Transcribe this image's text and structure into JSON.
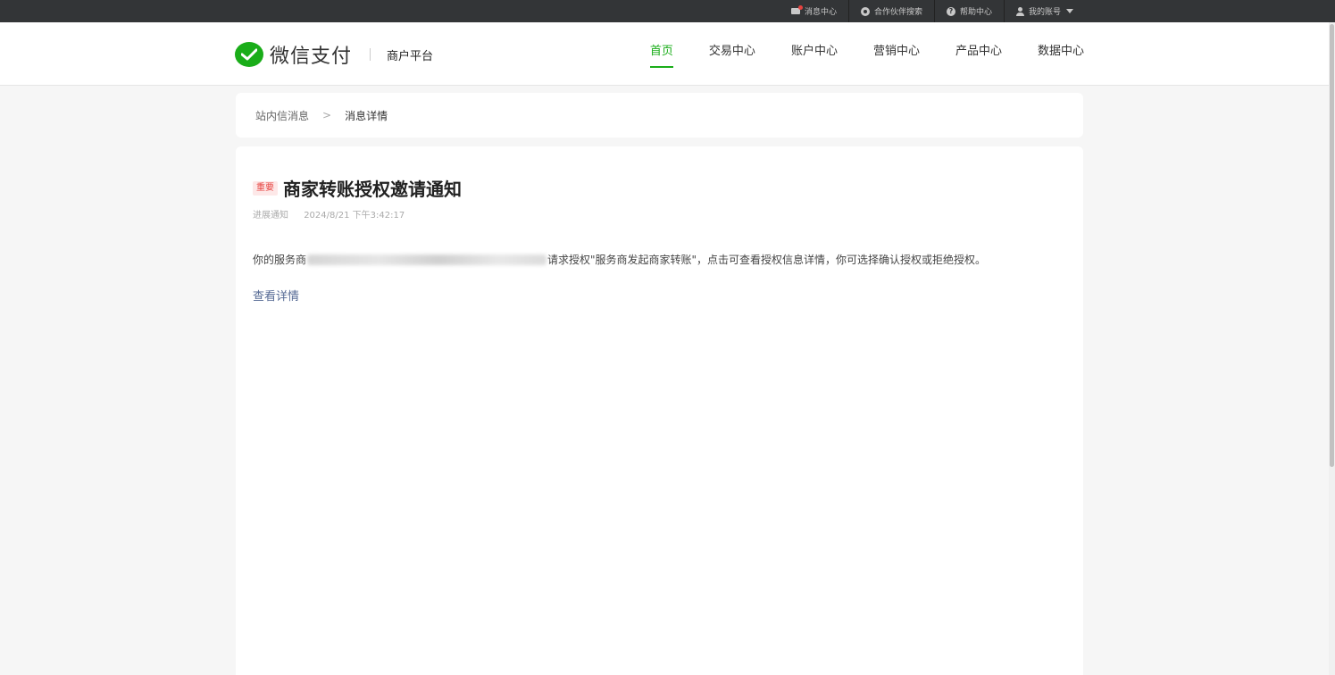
{
  "topbar": {
    "items": [
      {
        "label": "消息中心",
        "icon": "mail-icon"
      },
      {
        "label": "合作伙伴搜索",
        "icon": "partner-icon"
      },
      {
        "label": "帮助中心",
        "icon": "help-icon"
      },
      {
        "label": "我的账号",
        "icon": "user-icon"
      }
    ],
    "help_glyph": "?"
  },
  "header": {
    "logo_text": "微信支付",
    "logo_sub": "商户平台",
    "nav": [
      {
        "label": "首页",
        "active": true
      },
      {
        "label": "交易中心"
      },
      {
        "label": "账户中心"
      },
      {
        "label": "营销中心"
      },
      {
        "label": "产品中心"
      },
      {
        "label": "数据中心"
      }
    ]
  },
  "breadcrumb": {
    "parent": "站内信消息",
    "separator": ">",
    "current": "消息详情"
  },
  "message": {
    "tag": "重要",
    "title": "商家转账授权邀请通知",
    "category": "进展通知",
    "time": "2024/8/21 下午3:42:17",
    "body_prefix": "你的服务商",
    "body_suffix": "请求授权\"服务商发起商家转账\"，点击可查看授权信息详情，你可选择确认授权或拒绝授权。",
    "link": "查看详情"
  },
  "colors": {
    "brand_green": "#1aad19",
    "link_blue": "#576b95",
    "tag_red": "#e64340"
  }
}
